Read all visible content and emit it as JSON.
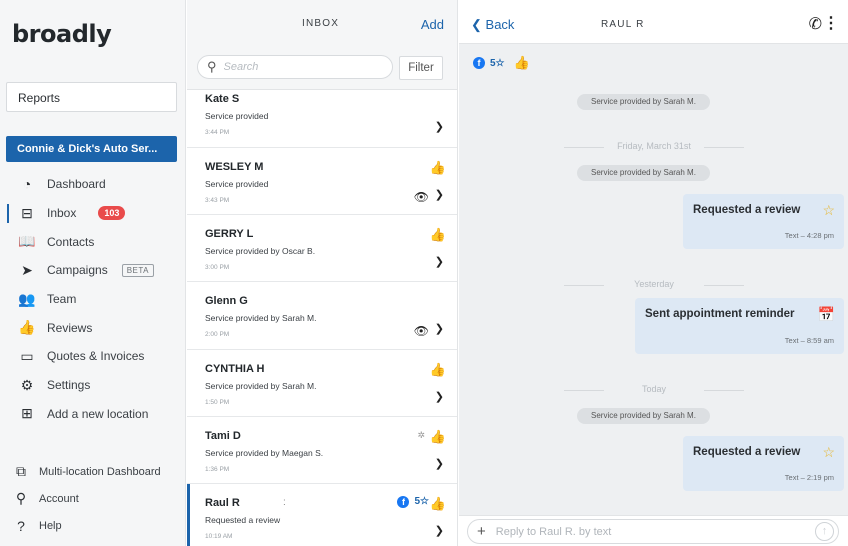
{
  "sidebar": {
    "logo": "broadly",
    "reports_label": "Reports",
    "location_label": "Connie & Dick's Auto Ser...",
    "items": [
      {
        "label": "Dashboard",
        "icon": "dashboard-icon",
        "glyph": "◔"
      },
      {
        "label": "Inbox",
        "icon": "inbox-icon",
        "glyph": "⊟",
        "badge": "103",
        "active": true
      },
      {
        "label": "Contacts",
        "icon": "contacts-icon",
        "glyph": "📖"
      },
      {
        "label": "Campaigns",
        "icon": "campaigns-icon",
        "glyph": "➤",
        "tag": "BETA"
      },
      {
        "label": "Team",
        "icon": "team-icon",
        "glyph": "👥"
      },
      {
        "label": "Reviews",
        "icon": "reviews-icon",
        "glyph": "👍"
      },
      {
        "label": "Quotes & Invoices",
        "icon": "quotes-icon",
        "glyph": "▭"
      },
      {
        "label": "Settings",
        "icon": "settings-icon",
        "glyph": "⚙"
      },
      {
        "label": "Add a new location",
        "icon": "add-location-icon",
        "glyph": "⊞"
      }
    ],
    "bottom_items": [
      {
        "label": "Multi-location Dashboard",
        "icon": "external-link-icon",
        "glyph": "⧉"
      },
      {
        "label": "Account",
        "icon": "account-icon",
        "glyph": "⚲"
      },
      {
        "label": "Help",
        "icon": "help-icon",
        "glyph": "?"
      }
    ]
  },
  "inbox": {
    "title": "INBOX",
    "add_label": "Add",
    "search_placeholder": "Search",
    "filter_label": "Filter",
    "conversations": [
      {
        "name": "Kate S",
        "subtitle": "Service provided",
        "time": "3:44 PM"
      },
      {
        "name": "WESLEY M",
        "subtitle": "Service provided",
        "time": "3:43 PM",
        "thumb": true,
        "eye": true
      },
      {
        "name": "GERRY L",
        "subtitle": "Service provided by Oscar B.",
        "time": "3:00 PM",
        "thumb": true
      },
      {
        "name": "Glenn G",
        "subtitle": "Service provided by Sarah M.",
        "time": "2:00 PM",
        "eye": true
      },
      {
        "name": "CYNTHIA H",
        "subtitle": "Service provided by Sarah M.",
        "time": "1:50 PM",
        "thumb": true
      },
      {
        "name": "Tami D",
        "subtitle": "Service provided by Maegan S.",
        "time": "1:36 PM",
        "thumb": true,
        "small_icon": true
      },
      {
        "name": "Raul R",
        "subtitle": "Requested a review",
        "time": "10:19 AM",
        "thumb": true,
        "rating": "5☆",
        "selected": true
      }
    ]
  },
  "chat": {
    "back_label": "Back",
    "title": "RAUL R",
    "rating_text": "5☆",
    "pill_1": "Service provided by Sarah M.",
    "date_1": "Friday, March 31st",
    "pill_2": "Service provided by Sarah M.",
    "bubble_1": {
      "text": "Requested a review",
      "meta": "Text – 4:28 pm"
    },
    "date_2": "Yesterday",
    "bubble_2": {
      "text": "Sent appointment reminder",
      "meta": "Text – 8:59 am"
    },
    "date_3": "Today",
    "pill_3": "Service provided by Sarah M.",
    "bubble_3": {
      "text": "Requested a review",
      "meta": "Text – 2:19 pm"
    },
    "reply_placeholder": "Reply to Raul R. by text"
  },
  "colors": {
    "brand_blue": "#1c64ab",
    "badge_red": "#e94b4b",
    "thumb_green": "#3fae49",
    "star_yellow": "#e7b62a"
  }
}
